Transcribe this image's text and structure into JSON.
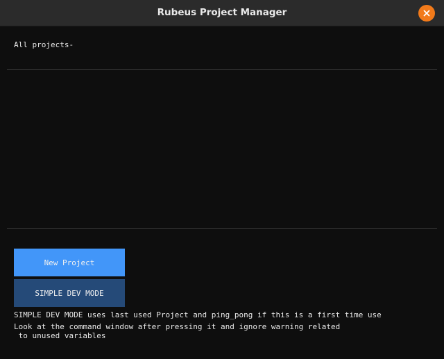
{
  "window": {
    "title": "Rubeus Project Manager",
    "close_icon": "close-icon",
    "close_color": "#f27a1a"
  },
  "main": {
    "all_projects_label": "All projects-",
    "projects": [],
    "new_project_label": "New Project",
    "simple_dev_label": "SIMPLE DEV MODE",
    "info_line1": "SIMPLE DEV MODE uses last used Project and ping_pong if this is a first time use",
    "info_line2": "Look at the command window after pressing it and ignore warning related",
    "info_line3": " to unused variables"
  },
  "colors": {
    "background": "#0e0e0e",
    "titlebar": "#2b2b2b",
    "new_project_button": "#4296f9",
    "simple_dev_button": "#254a78"
  }
}
